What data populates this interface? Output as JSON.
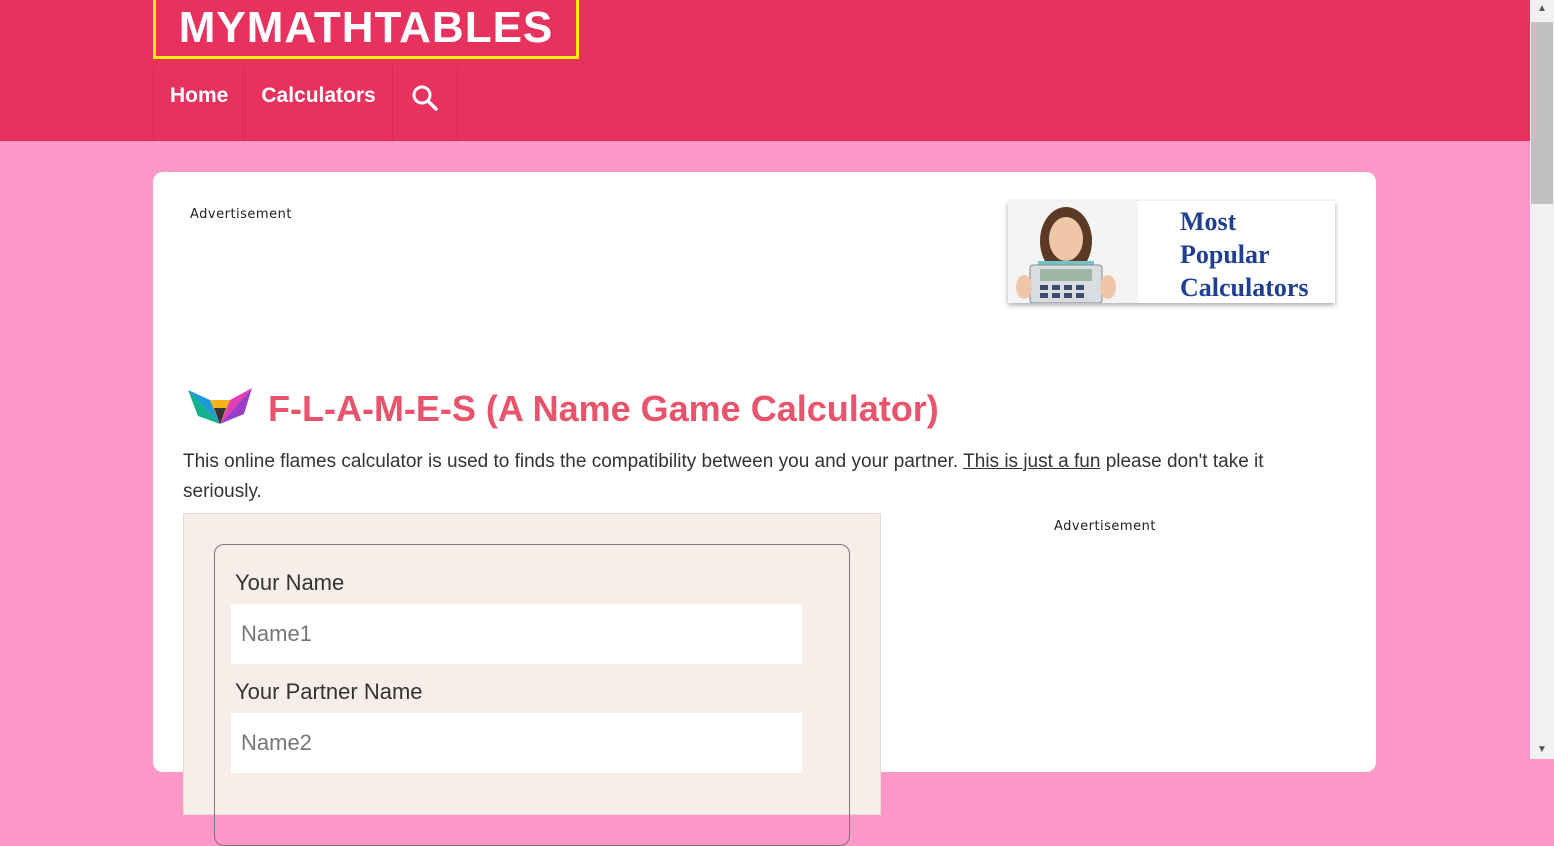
{
  "header": {
    "logo_text": "MYMATHTABLES",
    "nav": [
      {
        "label": "Home"
      },
      {
        "label": "Calculators"
      }
    ],
    "search_icon": "search-icon"
  },
  "ads": {
    "top_label": "Advertisement",
    "side_label": "Advertisement"
  },
  "promo": {
    "lines": [
      "Most",
      "Popular",
      "Calculators"
    ]
  },
  "page": {
    "title": "F-L-A-M-E-S (A Name Game Calculator)",
    "intro_before": "This online flames calculator is used to finds the compatibility between you and your partner. ",
    "intro_link": "This is just a fun",
    "intro_after": " please don't take it seriously."
  },
  "form": {
    "name_label": "Your Name",
    "name_placeholder": "Name1",
    "partner_label": "Your Partner Name",
    "partner_placeholder": "Name2"
  },
  "colors": {
    "header_bg": "#e8325e",
    "page_bg": "#ff97c9",
    "title": "#e8546c",
    "promo_text": "#1f3f93"
  }
}
